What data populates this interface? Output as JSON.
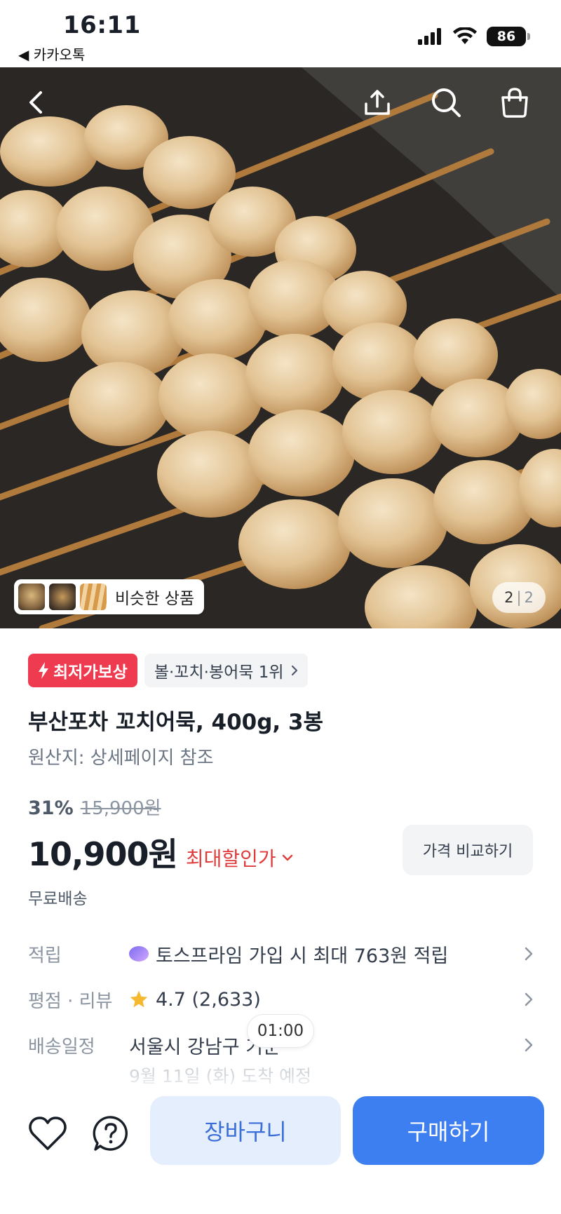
{
  "status_bar": {
    "time": "16:11",
    "back_app": "◀ 카카오톡",
    "battery": "86"
  },
  "hero": {
    "similar_products_label": "비슷한 상품",
    "page_current": "2",
    "page_total": "2",
    "icons": [
      "back-icon",
      "share-icon",
      "search-icon",
      "shopping-bag-icon"
    ]
  },
  "product": {
    "badge_lowest": "최저가보상",
    "badge_rank": "볼·꼬치·봉어묵 1위",
    "title": "부산포차 꼬치어묵, 400g, 3봉",
    "origin": "원산지: 상세페이지 참조",
    "discount_pct": "31%",
    "original_price": "15,900원",
    "price": "10,900원",
    "max_discount_label": "최대할인가",
    "compare_button": "가격 비교하기",
    "shipping": "무료배송"
  },
  "info_rows": {
    "points_label": "적립",
    "points_value": "토스프라임 가입 시 최대 763원 적립",
    "rating_label": "평점 · 리뷰",
    "rating_value": "4.7 (2,633)",
    "delivery_label": "배송일정",
    "delivery_value": "서울시 강남구 기준",
    "delivery_date": "9월 11일 (화) 도착 예정"
  },
  "toast": "01:00",
  "bottom_bar": {
    "cart_label": "장바구니",
    "buy_label": "구매하기"
  },
  "colors": {
    "accent": "#3d7ef0",
    "badge_red": "#ee3b4f",
    "discount_red": "#e03b3b",
    "star": "#f5b82e"
  }
}
